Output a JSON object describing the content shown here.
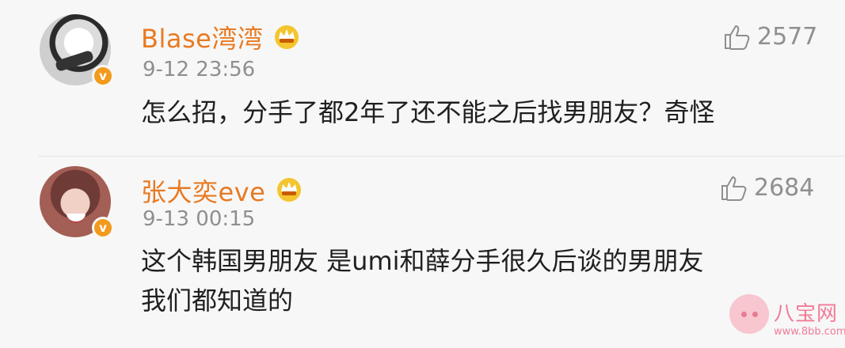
{
  "comments": [
    {
      "username": "Blase湾湾",
      "timestamp": "9-12 23:56",
      "likes": "2577",
      "content": [
        "怎么招，分手了都2年了还不能之后找男朋友？奇怪"
      ],
      "avatar": "avatar-1",
      "badge_icon": "verified-v-icon",
      "vip_icon": "crown-icon"
    },
    {
      "username": "张大奕eve",
      "timestamp": "9-13 00:15",
      "likes": "2684",
      "content": [
        "这个韩国男朋友 是umi和薛分手很久后谈的男朋友",
        "我们都知道的"
      ],
      "avatar": "avatar-2",
      "badge_icon": "verified-v-icon",
      "vip_icon": "crown-icon"
    }
  ],
  "watermark": {
    "name": "八宝网",
    "url": "www.8bb.com"
  },
  "colors": {
    "username": "#e87a22",
    "timestamp": "#8f8f8f",
    "content": "#1f1f1f",
    "background": "#f7f7f7",
    "verified_badge": "#f29a1d",
    "watermark": "#f07b97"
  }
}
